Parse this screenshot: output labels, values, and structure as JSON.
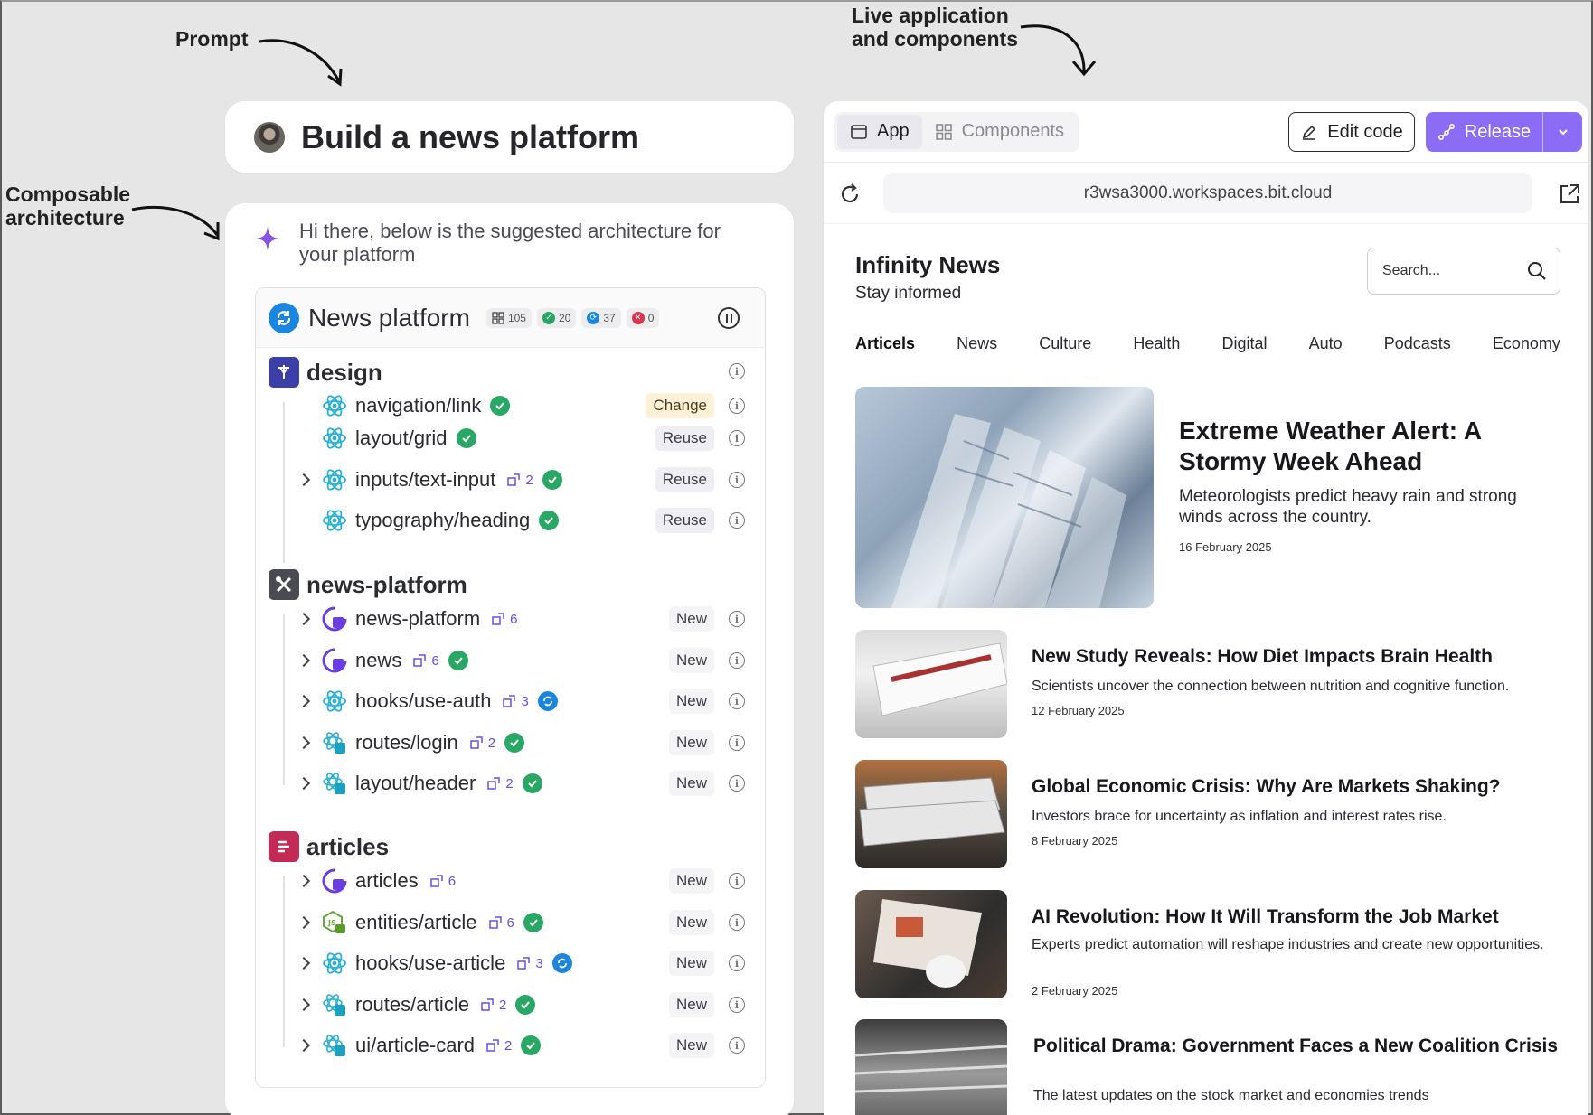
{
  "annotations": {
    "prompt": "Prompt",
    "composable_line1": "Composable",
    "composable_line2": "architecture",
    "live_line1": "Live application",
    "live_line2": "and components"
  },
  "prompt": {
    "title": "Build a news platform"
  },
  "assistant": {
    "intro": "Hi there, below is the suggested architecture for your platform"
  },
  "workspace": {
    "title": "News platform",
    "stats": {
      "components": "105",
      "ok": "20",
      "syncing": "37",
      "errors": "0"
    }
  },
  "scopes": [
    {
      "name": "design",
      "color": "#3d3fa8",
      "items": [
        {
          "name": "navigation/link",
          "deps": "",
          "status": "check",
          "tag": "Change",
          "expand": false
        },
        {
          "name": "layout/grid",
          "deps": "",
          "status": "check",
          "tag": "Reuse",
          "expand": false
        },
        {
          "name": "inputs/text-input",
          "deps": "2",
          "status": "check",
          "tag": "Reuse",
          "expand": true
        },
        {
          "name": "typography/heading",
          "deps": "",
          "status": "check",
          "tag": "Reuse",
          "expand": false
        }
      ]
    },
    {
      "name": "news-platform",
      "color": "#4a4a52",
      "items": [
        {
          "name": "news-platform",
          "deps": "6",
          "status": "",
          "tag": "New",
          "expand": true
        },
        {
          "name": "news",
          "deps": "6",
          "status": "check",
          "tag": "New",
          "expand": true
        },
        {
          "name": "hooks/use-auth",
          "deps": "3",
          "status": "sync",
          "tag": "New",
          "expand": true
        },
        {
          "name": "routes/login",
          "deps": "2",
          "status": "check",
          "tag": "New",
          "expand": true
        },
        {
          "name": "layout/header",
          "deps": "2",
          "status": "check",
          "tag": "New",
          "expand": true
        }
      ]
    },
    {
      "name": "articles",
      "color": "#c42a56",
      "items": [
        {
          "name": "articles",
          "deps": "6",
          "status": "",
          "tag": "New",
          "expand": true
        },
        {
          "name": "entities/article",
          "deps": "6",
          "status": "check",
          "tag": "New",
          "expand": true
        },
        {
          "name": "hooks/use-article",
          "deps": "3",
          "status": "sync",
          "tag": "New",
          "expand": true
        },
        {
          "name": "routes/article",
          "deps": "2",
          "status": "check",
          "tag": "New",
          "expand": true
        },
        {
          "name": "ui/article-card",
          "deps": "2",
          "status": "check",
          "tag": "New",
          "expand": true
        }
      ]
    }
  ],
  "app_panel": {
    "tab_app": "App",
    "tab_components": "Components",
    "edit_code": "Edit code",
    "release": "Release",
    "url": "r3wsa3000.workspaces.bit.cloud"
  },
  "site": {
    "brand": "Infinity News",
    "tagline": "Stay informed",
    "search_placeholder": "Search...",
    "nav": [
      "Articels",
      "News",
      "Culture",
      "Health",
      "Digital",
      "Auto",
      "Podcasts",
      "Economy"
    ],
    "hero": {
      "title": "Extreme Weather Alert: A Stormy Week Ahead",
      "desc": "Meteorologists predict heavy rain and strong winds across the country.",
      "date": "16 February 2025"
    },
    "articles": [
      {
        "title": "New Study Reveals: How Diet Impacts Brain Health",
        "desc": "Scientists uncover the connection between nutrition and cognitive function.",
        "date": "12 February 2025"
      },
      {
        "title": "Global Economic Crisis: Why Are Markets Shaking?",
        "desc": "Investors brace for uncertainty as inflation and interest rates rise.",
        "date": "8 February 2025"
      },
      {
        "title": "AI Revolution: How It Will Transform the Job Market",
        "desc": "Experts predict automation will reshape industries and create new opportunities.",
        "date": "2 February 2025"
      },
      {
        "title": "Political Drama: Government Faces a New Coalition Crisis",
        "desc": "The latest updates on the stock market and economies trends",
        "date": ""
      }
    ]
  }
}
